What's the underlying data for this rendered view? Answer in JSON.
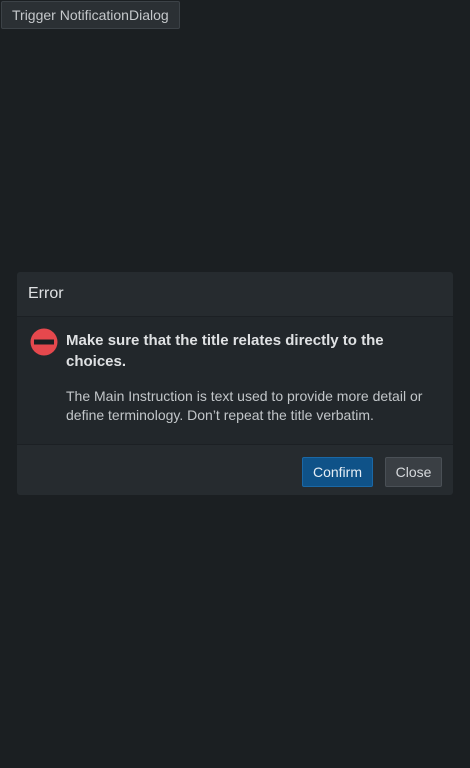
{
  "trigger": {
    "label": "Trigger NotificationDialog"
  },
  "dialog": {
    "title": "Error",
    "icon": "error-icon",
    "icon_color": "#e5484d",
    "main_instruction": "Make sure that the title relates directly to the choices.",
    "content": "The Main Instruction is text used to provide more detail or define terminology. Don’t repeat the title verbatim.",
    "buttons": {
      "confirm": "Confirm",
      "close": "Close"
    }
  }
}
